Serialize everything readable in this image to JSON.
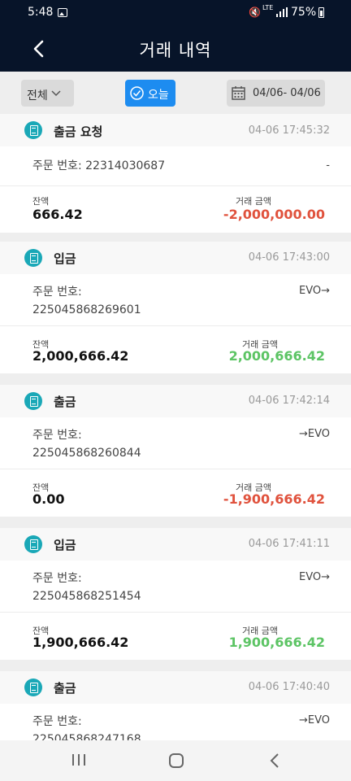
{
  "status_bar": {
    "time": "5:48",
    "network": "LTE",
    "battery": "75%"
  },
  "header": {
    "title": "거래 내역"
  },
  "filters": {
    "all_label": "전체",
    "today_label": "오늘",
    "date_range": "04/06- 04/06",
    "today_color": "#1d8cf0"
  },
  "colors": {
    "negative": "#e0523d",
    "positive": "#5cc464",
    "header_bg": "#071429",
    "icon": "#1aa8b7"
  },
  "labels": {
    "balance": "잔액",
    "amount": "거래 금액"
  },
  "transactions": [
    {
      "type": "출금 요청",
      "time": "04-06 17:45:32",
      "order_label": "주문 번호: 22314030687",
      "order_number": "",
      "direction": "-",
      "balance": "666.42",
      "amount": "-2,000,000.00",
      "sign": "negative"
    },
    {
      "type": "입금",
      "time": "04-06 17:43:00",
      "order_label": "주문 번호:",
      "order_number": "225045868269601",
      "direction": "EVO→",
      "balance": "2,000,666.42",
      "amount": "2,000,666.42",
      "sign": "positive"
    },
    {
      "type": "출금",
      "time": "04-06 17:42:14",
      "order_label": "주문 번호:",
      "order_number": "225045868260844",
      "direction": "→EVO",
      "balance": "0.00",
      "amount": "-1,900,666.42",
      "sign": "negative"
    },
    {
      "type": "입금",
      "time": "04-06 17:41:11",
      "order_label": "주문 번호:",
      "order_number": "225045868251454",
      "direction": "EVO→",
      "balance": "1,900,666.42",
      "amount": "1,900,666.42",
      "sign": "positive"
    },
    {
      "type": "출금",
      "time": "04-06 17:40:40",
      "order_label": "주문 번호:",
      "order_number": "225045868247168",
      "direction": "→EVO",
      "balance": "",
      "amount": "",
      "sign": "negative"
    }
  ]
}
